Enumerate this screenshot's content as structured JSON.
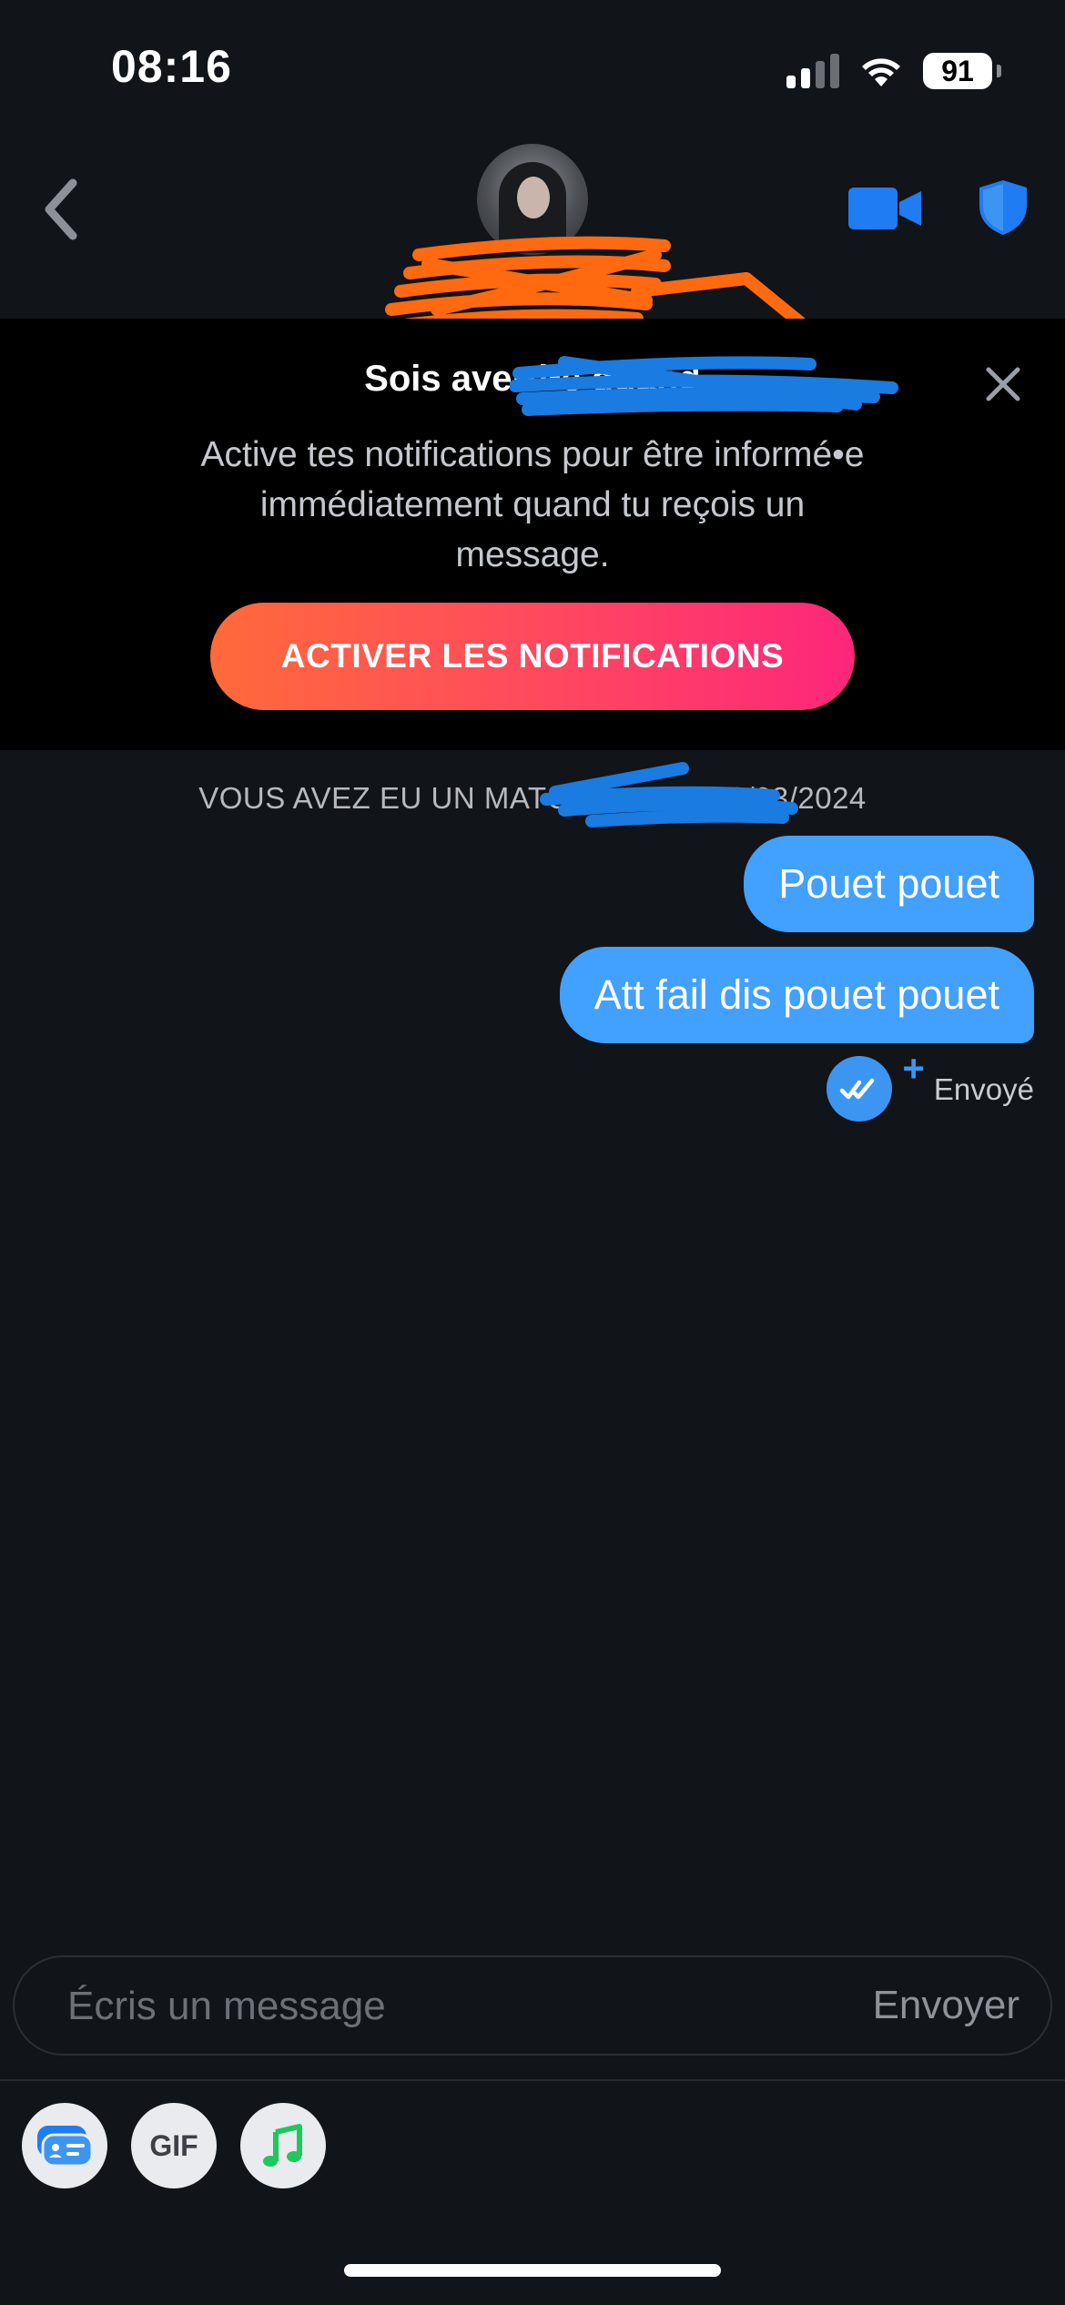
{
  "status_bar": {
    "time": "08:16",
    "battery": "91"
  },
  "header": {
    "back_icon": "chevron-left-icon",
    "video_icon": "video-camera-icon",
    "safety_icon": "shield-icon"
  },
  "notification_banner": {
    "title": "Sois averti•e quand",
    "body": "Active tes notifications pour être informé•e immédiatement quand tu reçois un message.",
    "button_label": "ACTIVER LES NOTIFICATIONS",
    "close_icon": "close-icon"
  },
  "match_info": {
    "text": "VOUS AVEZ EU UN MATCH A … LE 23/03/2024"
  },
  "messages": [
    {
      "text": "Pouet pouet",
      "from": "me"
    },
    {
      "text": "Att fail dis pouet pouet",
      "from": "me"
    }
  ],
  "read_status": {
    "label": "Envoyé",
    "plus": "+"
  },
  "composer": {
    "placeholder": "Écris un message",
    "send_label": "Envoyer"
  },
  "toolbar": {
    "gif_label": "GIF",
    "sticker_icon": "sticker-icon",
    "music_icon": "music-note-icon"
  },
  "colors": {
    "background": "#111418",
    "bubble": "#42a0ff",
    "accent_blue": "#1f7cf2",
    "gradient_start": "#ff6a3a",
    "gradient_end": "#fd267a"
  }
}
